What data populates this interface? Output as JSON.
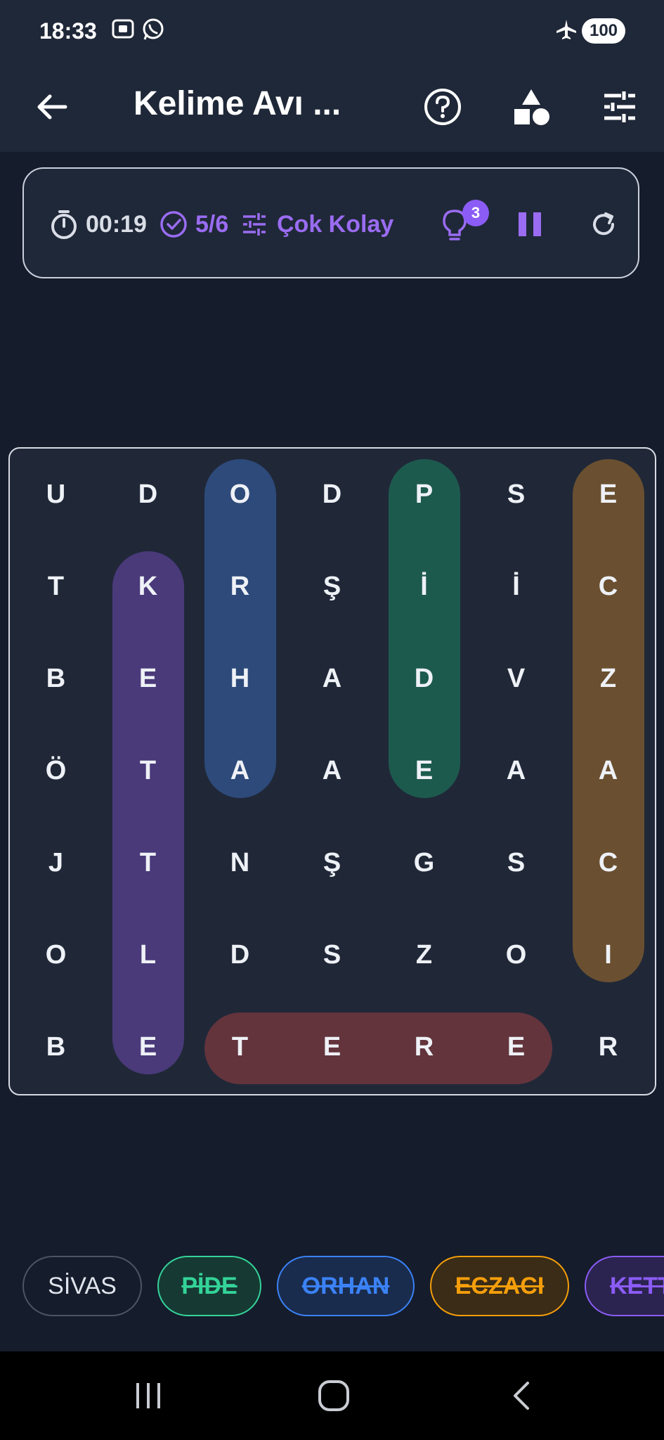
{
  "status_bar": {
    "time": "18:33",
    "icons": [
      "screen-recorder-icon",
      "whatsapp-icon",
      "airplane-mode-icon"
    ],
    "battery": "100"
  },
  "app_bar": {
    "title": "Kelime Avı ...",
    "icons": [
      "back-arrow-icon",
      "help-icon",
      "shapes-icon",
      "tune-icon"
    ]
  },
  "game_info": {
    "timer": "00:19",
    "progress": "5/6",
    "difficulty": "Çok Kolay",
    "hints_badge": "3",
    "icons": [
      "stopwatch-icon",
      "check-circle-icon",
      "difficulty-sliders-icon",
      "lightbulb-icon",
      "pause-icon",
      "refresh-icon"
    ]
  },
  "grid": {
    "rows": [
      [
        "U",
        "D",
        "O",
        "D",
        "P",
        "S",
        "E"
      ],
      [
        "T",
        "K",
        "R",
        "Ş",
        "İ",
        "İ",
        "C"
      ],
      [
        "B",
        "E",
        "H",
        "A",
        "D",
        "V",
        "Z"
      ],
      [
        "Ö",
        "T",
        "A",
        "A",
        "E",
        "A",
        "A"
      ],
      [
        "J",
        "T",
        "N",
        "Ş",
        "G",
        "S",
        "C"
      ],
      [
        "O",
        "L",
        "D",
        "S",
        "Z",
        "O",
        "I"
      ],
      [
        "B",
        "E",
        "T",
        "E",
        "R",
        "E",
        "R"
      ]
    ],
    "found_words": [
      {
        "word": "KETTLE",
        "color": "#4a3a7a"
      },
      {
        "word": "ORHAN",
        "color": "#2d4a7a"
      },
      {
        "word": "PİDE",
        "color": "#1d5a4e"
      },
      {
        "word": "ECZACI",
        "color": "#6a5030"
      },
      {
        "word": "TERE",
        "color": "#63343c"
      }
    ]
  },
  "words": [
    {
      "text": "SİVAS",
      "found": false,
      "color": "#e0e4ec",
      "border": "#4b5566",
      "bg": "transparent"
    },
    {
      "text": "PİDE",
      "found": true,
      "color": "#34d399",
      "border": "#34d399",
      "bg": "#163a33"
    },
    {
      "text": "ORHAN",
      "found": true,
      "color": "#3b82f6",
      "border": "#3b82f6",
      "bg": "#1a2c4d"
    },
    {
      "text": "ECZACI",
      "found": true,
      "color": "#f59e0b",
      "border": "#f59e0b",
      "bg": "#3a2c17"
    },
    {
      "text": "KETTLE",
      "found": true,
      "color": "#8b5cf6",
      "border": "#8b5cf6",
      "bg": "#2c2450"
    }
  ],
  "nav_bar": {
    "icons": [
      "recent-apps-icon",
      "home-icon",
      "back-icon"
    ]
  }
}
